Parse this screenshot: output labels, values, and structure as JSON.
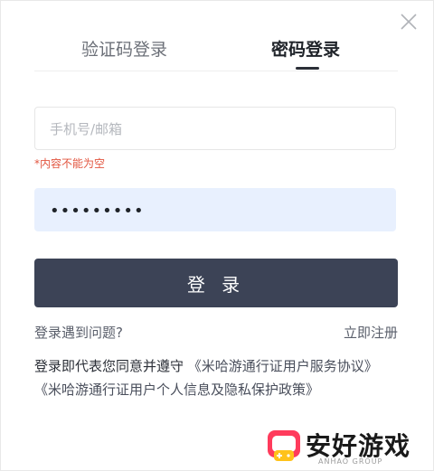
{
  "tabs": [
    {
      "label": "验证码登录",
      "active": false
    },
    {
      "label": "密码登录",
      "active": true
    }
  ],
  "form": {
    "account_placeholder": "手机号/邮箱",
    "account_value": "",
    "account_error": "*内容不能为空",
    "password_value": "•••••••••",
    "submit_label": "登 录"
  },
  "links": {
    "help": "登录遇到问题?",
    "register": "立即注册"
  },
  "agreement": {
    "prefix": "登录即代表您同意并遵守",
    "user_agreement": "《米哈游通行证用户服务协议》",
    "privacy_policy": "《米哈游通行证用户个人信息及隐私保护政策》"
  },
  "watermark": {
    "name": "安好游戏",
    "sub": "ANHAO GROUP"
  },
  "colors": {
    "primary_button": "#3c4356",
    "error": "#e2553f",
    "autofill_bg": "#e8f0fe",
    "logo_red": "#ff3b5c",
    "logo_yellow": "#ffc21a"
  }
}
